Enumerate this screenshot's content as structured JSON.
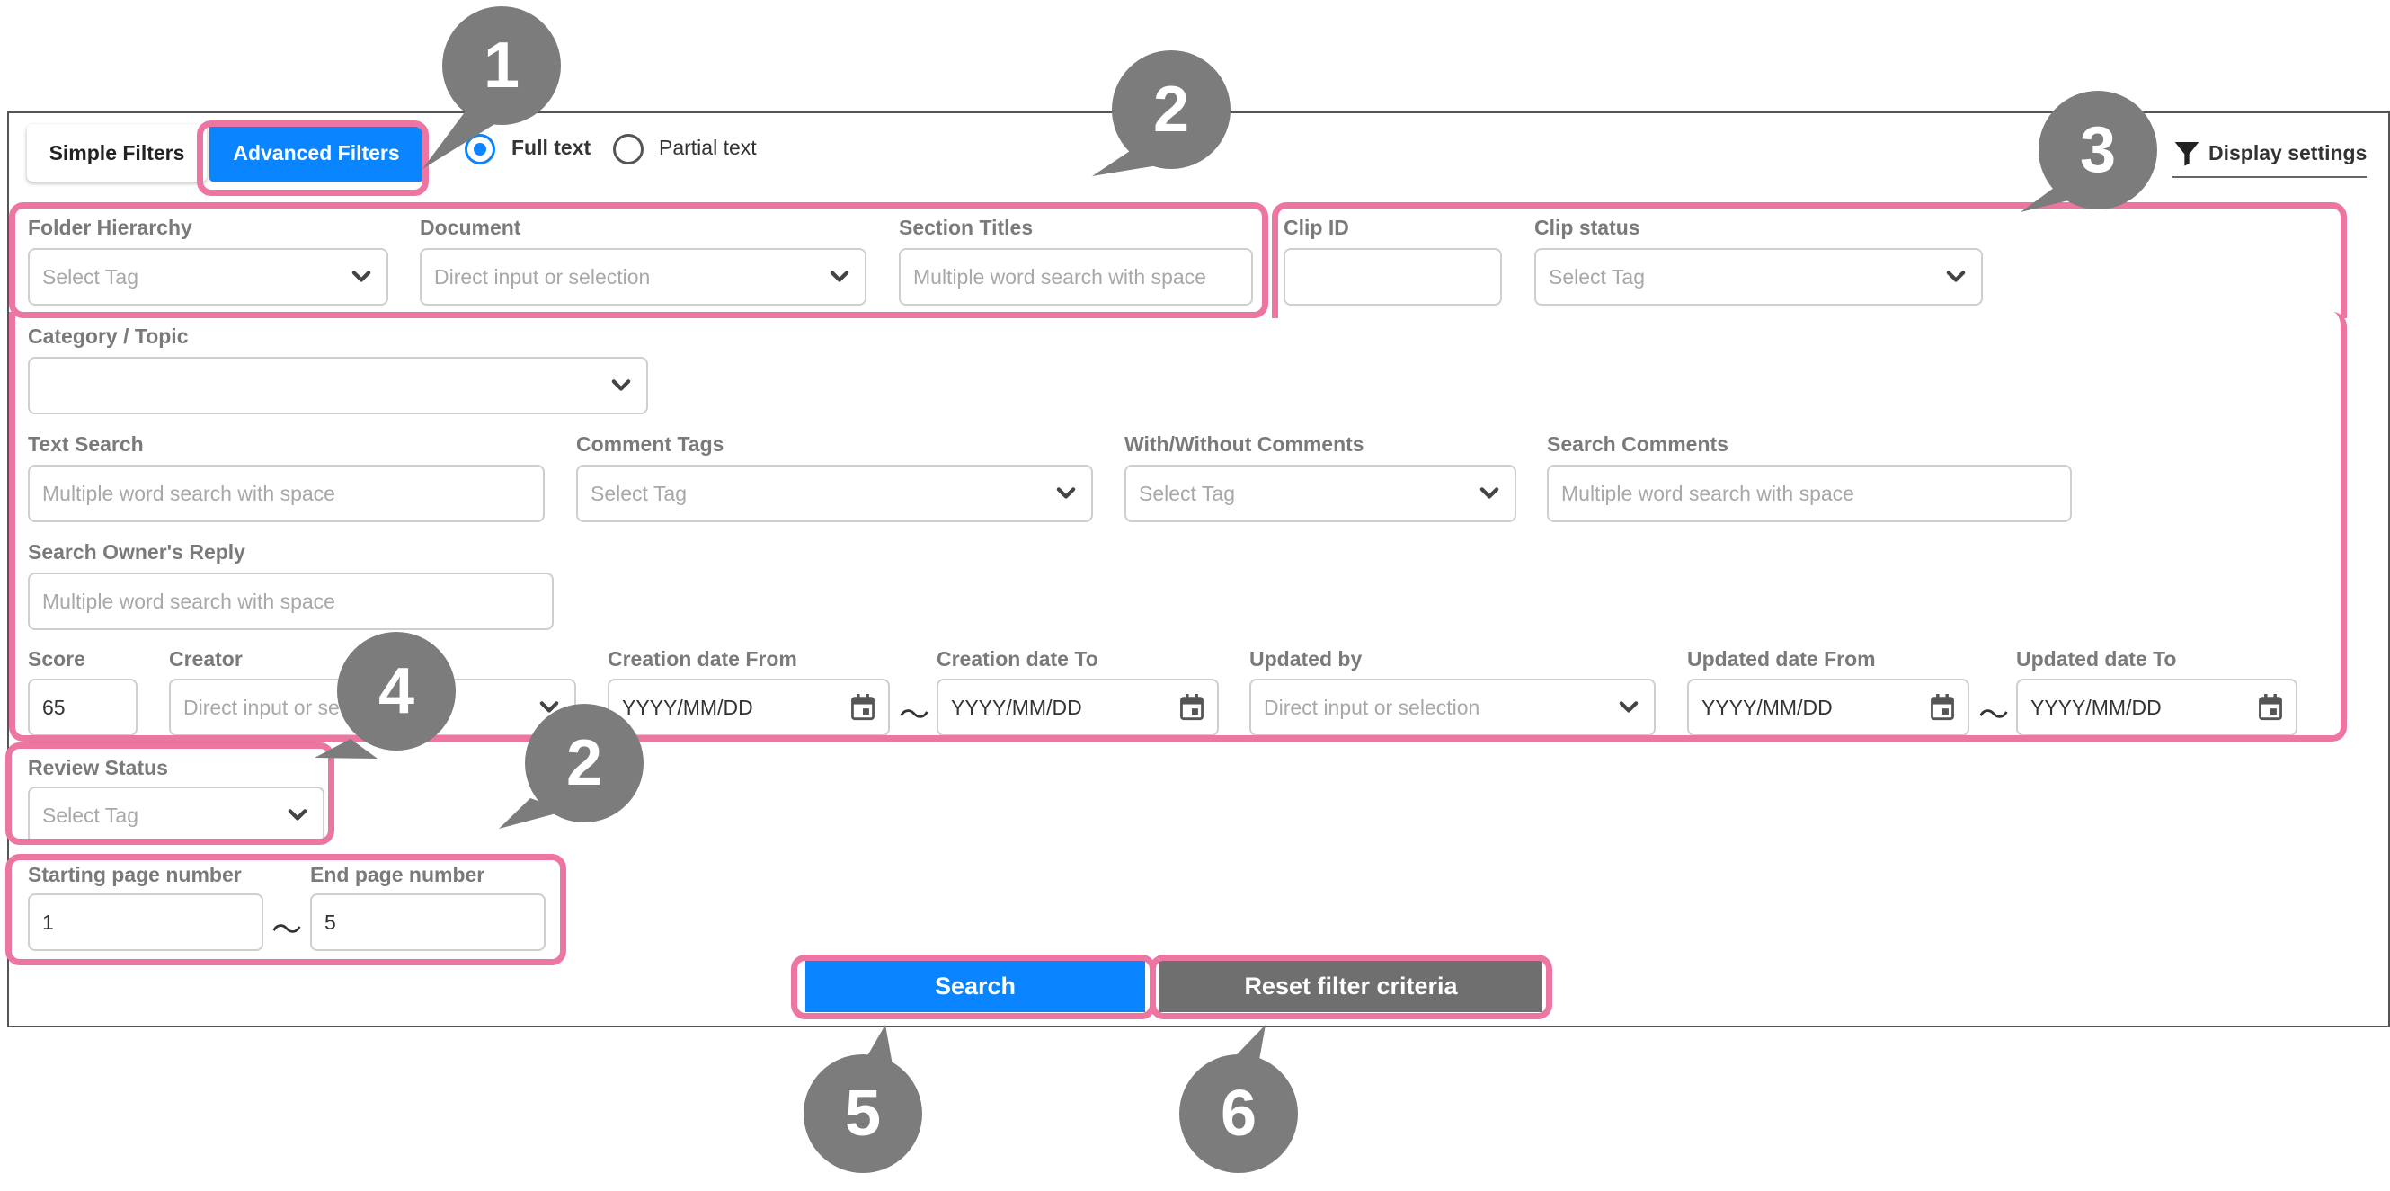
{
  "tabs": {
    "simple": "Simple Filters",
    "advanced": "Advanced Filters"
  },
  "match_mode": {
    "full": "Full text",
    "partial": "Partial text",
    "selected": "full"
  },
  "display_settings": "Display settings",
  "fields": {
    "folder_hierarchy": {
      "label": "Folder Hierarchy",
      "placeholder": "Select Tag"
    },
    "document": {
      "label": "Document",
      "placeholder": "Direct input or selection"
    },
    "section_titles": {
      "label": "Section Titles",
      "placeholder": "Multiple word search with space"
    },
    "clip_id": {
      "label": "Clip ID",
      "value": ""
    },
    "clip_status": {
      "label": "Clip status",
      "placeholder": "Select Tag"
    },
    "category_topic": {
      "label": "Category / Topic",
      "value": ""
    },
    "text_search": {
      "label": "Text Search",
      "placeholder": "Multiple word search with space"
    },
    "comment_tags": {
      "label": "Comment Tags",
      "placeholder": "Select Tag"
    },
    "with_without_comments": {
      "label": "With/Without Comments",
      "placeholder": "Select Tag"
    },
    "search_comments": {
      "label": "Search Comments",
      "placeholder": "Multiple word search with space"
    },
    "search_owner_reply": {
      "label": "Search Owner's Reply",
      "placeholder": "Multiple word search with space"
    },
    "score": {
      "label": "Score",
      "value": "65"
    },
    "creator": {
      "label": "Creator",
      "placeholder": "Direct input or se"
    },
    "creation_date_from": {
      "label": "Creation date From",
      "placeholder": "YYYY/MM/DD"
    },
    "creation_date_to": {
      "label": "Creation date To",
      "placeholder": "YYYY/MM/DD"
    },
    "updated_by": {
      "label": "Updated by",
      "placeholder": "Direct input or selection"
    },
    "updated_date_from": {
      "label": "Updated date From",
      "placeholder": "YYYY/MM/DD"
    },
    "updated_date_to": {
      "label": "Updated date To",
      "placeholder": "YYYY/MM/DD"
    },
    "review_status": {
      "label": "Review Status",
      "placeholder": "Select Tag"
    },
    "starting_page": {
      "label": "Starting page number",
      "value": "1"
    },
    "end_page": {
      "label": "End page number",
      "value": "5"
    }
  },
  "range_separator": "〜",
  "buttons": {
    "search": "Search",
    "reset": "Reset filter criteria"
  },
  "callouts": {
    "c1": "1",
    "c2a": "2",
    "c2b": "2",
    "c3": "3",
    "c4": "4",
    "c5": "5",
    "c6": "6"
  },
  "colors": {
    "accent": "#0a84ff",
    "reset": "#6f6f6f",
    "highlight": "#ec75a2",
    "callout": "#7c7c7c"
  }
}
